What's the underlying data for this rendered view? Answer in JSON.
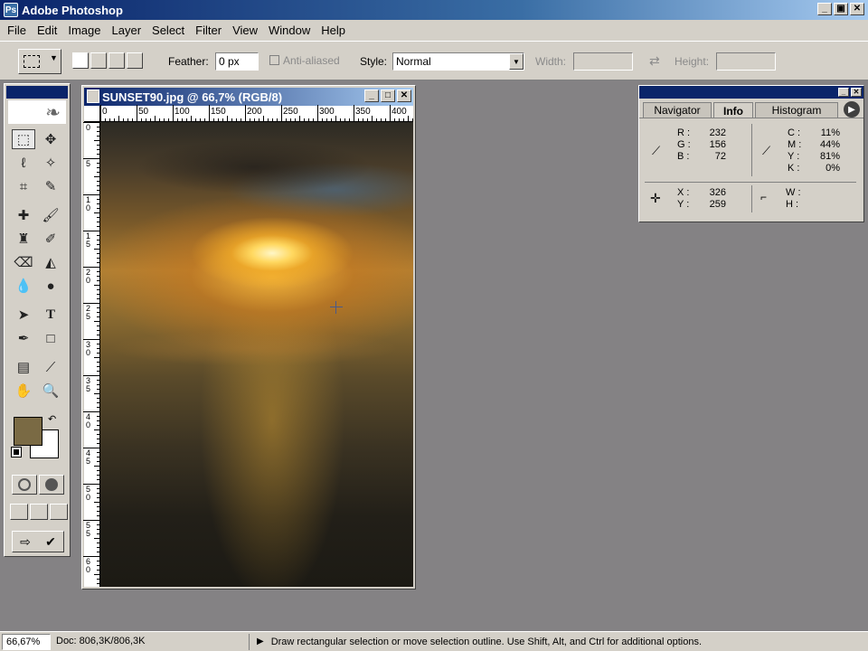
{
  "app": {
    "title": "Adobe Photoshop",
    "window_buttons": [
      "_",
      "▣",
      "✕"
    ]
  },
  "menu": [
    "File",
    "Edit",
    "Image",
    "Layer",
    "Select",
    "Filter",
    "View",
    "Window",
    "Help"
  ],
  "options": {
    "feather_label": "Feather:",
    "feather_value": "0 px",
    "antialiased_label": "Anti-aliased",
    "style_label": "Style:",
    "style_value": "Normal",
    "width_label": "Width:",
    "height_label": "Height:"
  },
  "document": {
    "title": "SUNSET90.jpg @ 66,7% (RGB/8)",
    "hruler_ticks": [
      "0",
      "50",
      "100",
      "150",
      "200",
      "250",
      "300",
      "350",
      "400"
    ],
    "vruler_ticks": [
      "0",
      "5",
      "1 0",
      "1 5",
      "2 0",
      "2 5",
      "3 0",
      "3 5",
      "4 0",
      "4 5",
      "5 0",
      "5 5",
      "6 0"
    ]
  },
  "info": {
    "tabs": [
      "Navigator",
      "Info",
      "Histogram"
    ],
    "active_tab": "Info",
    "rgb": {
      "r_label": "R :",
      "r": "232",
      "g_label": "G :",
      "g": "156",
      "b_label": "B :",
      "b": "72"
    },
    "cmyk": {
      "c_label": "C :",
      "c": "11%",
      "m_label": "M :",
      "m": "44%",
      "y_label": "Y :",
      "y": "81%",
      "k_label": "K :",
      "k": "0%"
    },
    "pos": {
      "x_label": "X :",
      "x": "326",
      "y_label": "Y :",
      "y": "259"
    },
    "size": {
      "w_label": "W :",
      "h_label": "H :"
    }
  },
  "colors": {
    "foreground": "#7a6a44",
    "background": "#ffffff"
  },
  "status": {
    "zoom": "66,67%",
    "doc": "Doc: 806,3K/806,3K",
    "hint": "Draw rectangular selection or move selection outline.  Use Shift, Alt, and Ctrl for additional options."
  }
}
